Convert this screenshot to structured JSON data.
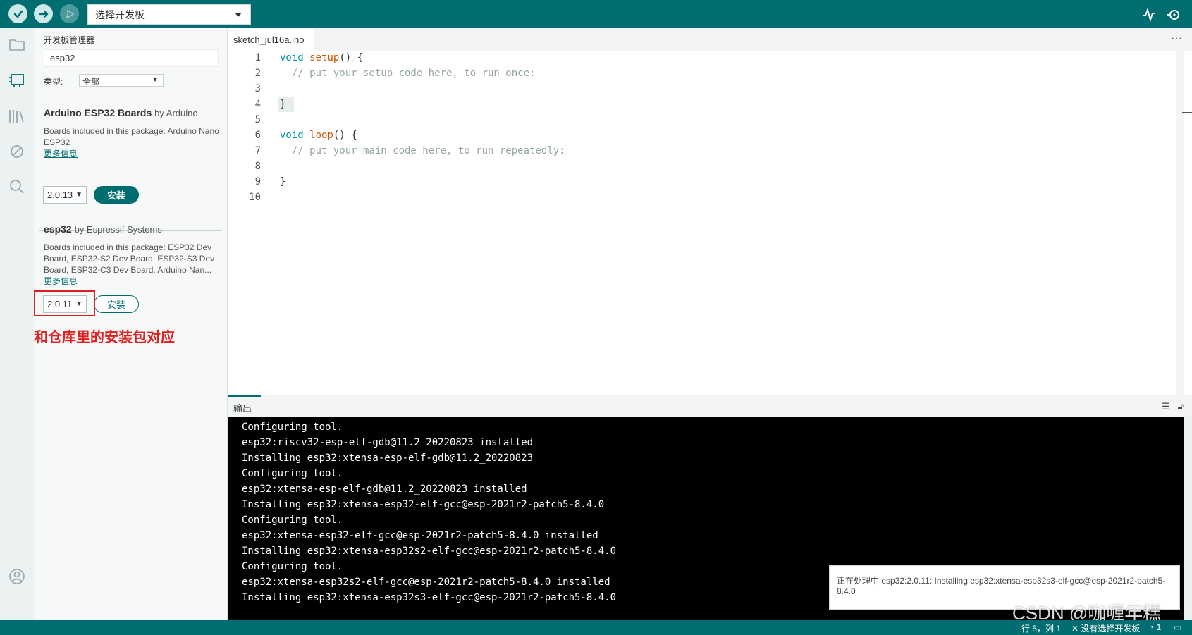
{
  "toolbar": {
    "board_select": "选择开发板"
  },
  "boards_panel": {
    "title": "开发板管理器",
    "search_value": "esp32",
    "type_label": "类型:",
    "type_value": "全部",
    "packages": [
      {
        "name": "Arduino ESP32 Boards",
        "by": "by Arduino",
        "desc": "Boards included in this package: Arduino Nano ESP32",
        "more": "更多信息",
        "version": "2.0.13",
        "install_label": "安装"
      },
      {
        "name": "esp32",
        "by": "by Espressif Systems",
        "desc": "Boards included in this package: ESP32 Dev Board, ESP32-S2 Dev Board, ESP32-S3 Dev Board, ESP32-C3 Dev Board, Arduino Nan...",
        "more": "更多信息",
        "version": "2.0.11",
        "install_label": "安装"
      }
    ],
    "annotation": "和仓库里的安装包对应"
  },
  "editor": {
    "tab_name": "sketch_jul16a.ino",
    "more": "···",
    "line_numbers": [
      "1",
      "2",
      "3",
      "4",
      "5",
      "6",
      "7",
      "8",
      "9",
      "10"
    ],
    "code": {
      "l1_kw": "void",
      "l1_fn": "setup",
      "l1_rest": "() {",
      "l2": "  // put your setup code here, to run once:",
      "l4": "}",
      "l6_kw": "void",
      "l6_fn": "loop",
      "l6_rest": "() {",
      "l7": "  // put your main code here, to run repeatedly:",
      "l9": "}"
    }
  },
  "output": {
    "title": "输出",
    "lines": [
      "Configuring tool.",
      "esp32:riscv32-esp-elf-gdb@11.2_20220823 installed",
      "Installing esp32:xtensa-esp-elf-gdb@11.2_20220823",
      "Configuring tool.",
      "esp32:xtensa-esp-elf-gdb@11.2_20220823 installed",
      "Installing esp32:xtensa-esp32-elf-gcc@esp-2021r2-patch5-8.4.0",
      "Configuring tool.",
      "esp32:xtensa-esp32-elf-gcc@esp-2021r2-patch5-8.4.0 installed",
      "Installing esp32:xtensa-esp32s2-elf-gcc@esp-2021r2-patch5-8.4.0",
      "Configuring tool.",
      "esp32:xtensa-esp32s2-elf-gcc@esp-2021r2-patch5-8.4.0 installed",
      "Installing esp32:xtensa-esp32s3-elf-gcc@esp-2021r2-patch5-8.4.0"
    ]
  },
  "toast": {
    "message": "正在处理中 esp32:2.0.11: Installing esp32:xtensa-esp32s3-elf-gcc@esp-2021r2-patch5-8.4.0"
  },
  "statusbar": {
    "position": "行 5，列 1",
    "board": "✕ 没有选择开发板",
    "notifications": "1"
  },
  "watermark": "CSDN @咖喱年糕"
}
